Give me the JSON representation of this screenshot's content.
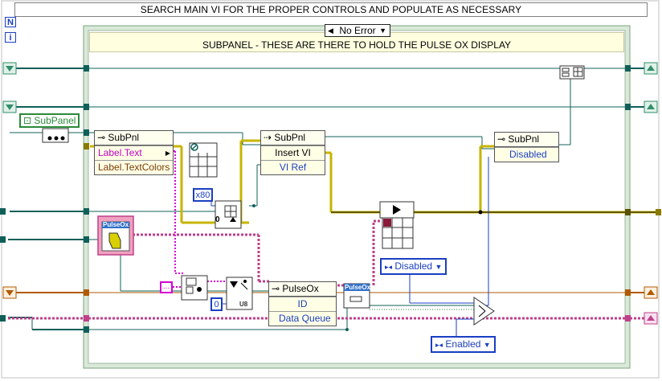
{
  "banner": "SEARCH MAIN VI FOR THE PROPER CONTROLS AND POPULATE AS NECESSARY",
  "case_structure": {
    "selector": "No Error",
    "comment": "SUBPANEL - THESE ARE THERE TO HOLD THE PULSE OX DISPLAY"
  },
  "tunnels": {
    "n_label": "N",
    "i_label": "i"
  },
  "subpanel_control": "SubPanel",
  "property_node_1": {
    "title": "SubPnl",
    "props": [
      "Label.Text",
      "Label.TextColors"
    ]
  },
  "invoke_node": {
    "title": "SubPnl",
    "method": "Insert VI",
    "param": "VI Ref"
  },
  "property_node_2": {
    "title": "SubPnl",
    "props": [
      "Disabled"
    ]
  },
  "pulseox_node": {
    "title": "PulseOx",
    "props": [
      "ID",
      "Data Queue"
    ]
  },
  "pulseox_ref_label": "PulseOx",
  "pulseox_class_label": "PulseOx",
  "constants": {
    "x80": "x80",
    "zero_a": "0",
    "zero_b": "0",
    "u8": "U8",
    "string_const": "...",
    "disabled_enum": "Disabled",
    "enabled_enum": "Enabled"
  },
  "colors": {
    "error_wire": "#c8b400",
    "ref_wire": "#10605a",
    "string_wire": "#d400d4",
    "class_wire": "#c0408a",
    "enum_wire": "#1a3fc2",
    "brown_wire": "#b05a00",
    "structure_border": "#7ea37e"
  }
}
